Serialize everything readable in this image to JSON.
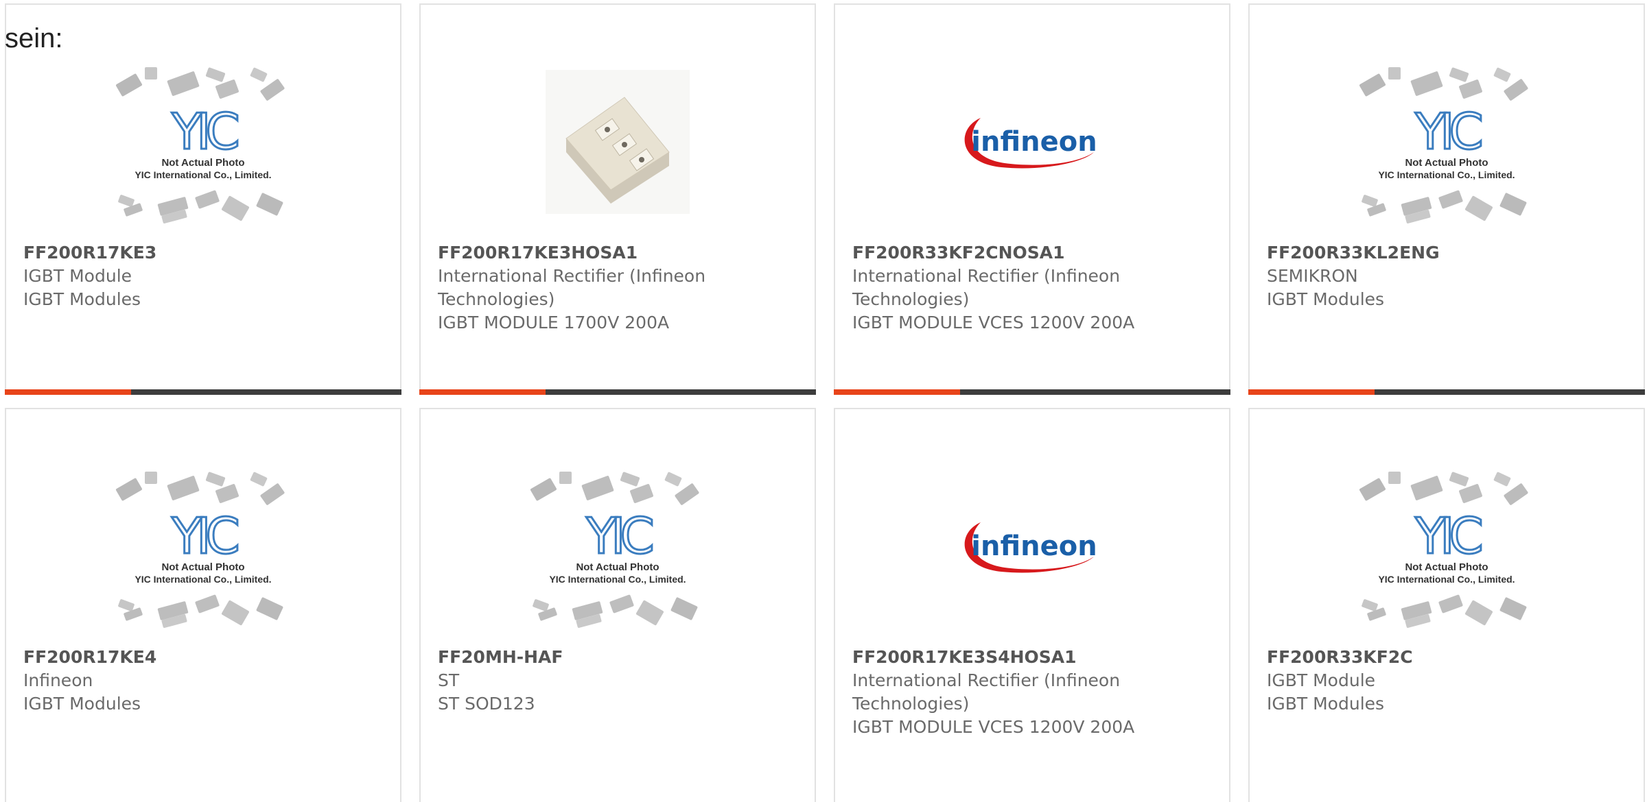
{
  "lead_text": "sein:",
  "colors": {
    "accent": "#e8441a",
    "bar": "#3d3d3d",
    "infineon_red": "#d7191c",
    "infineon_blue": "#1a5fa8",
    "yic_blue": "#3b7dbf"
  },
  "placeholder_image": {
    "line1": "Not Actual Photo",
    "line2": "YIC International Co., Limited."
  },
  "infineon_logo_text": "infineon",
  "products": [
    {
      "image": "yic-placeholder",
      "part_number": "FF200R17KE3",
      "lines": [
        "IGBT Module",
        "IGBT Modules"
      ]
    },
    {
      "image": "igbt-module-photo",
      "part_number": "FF200R17KE3HOSA1",
      "lines": [
        "International Rectifier (Infineon",
        "Technologies)",
        "IGBT MODULE 1700V 200A"
      ]
    },
    {
      "image": "infineon-logo",
      "part_number": "FF200R33KF2CNOSA1",
      "lines": [
        "International Rectifier (Infineon",
        "Technologies)",
        "IGBT MODULE VCES 1200V 200A"
      ]
    },
    {
      "image": "yic-placeholder",
      "part_number": "FF200R33KL2ENG",
      "lines": [
        "SEMIKRON",
        "IGBT Modules"
      ]
    },
    {
      "image": "yic-placeholder",
      "part_number": "FF200R17KE4",
      "lines": [
        "Infineon",
        "IGBT Modules"
      ]
    },
    {
      "image": "yic-placeholder",
      "part_number": "FF20MH-HAF",
      "lines": [
        "ST",
        "ST SOD123"
      ]
    },
    {
      "image": "infineon-logo",
      "part_number": "FF200R17KE3S4HOSA1",
      "lines": [
        "International Rectifier (Infineon",
        "Technologies)",
        "IGBT MODULE VCES 1200V 200A"
      ]
    },
    {
      "image": "yic-placeholder",
      "part_number": "FF200R33KF2C",
      "lines": [
        "IGBT Module",
        "IGBT Modules"
      ]
    }
  ]
}
